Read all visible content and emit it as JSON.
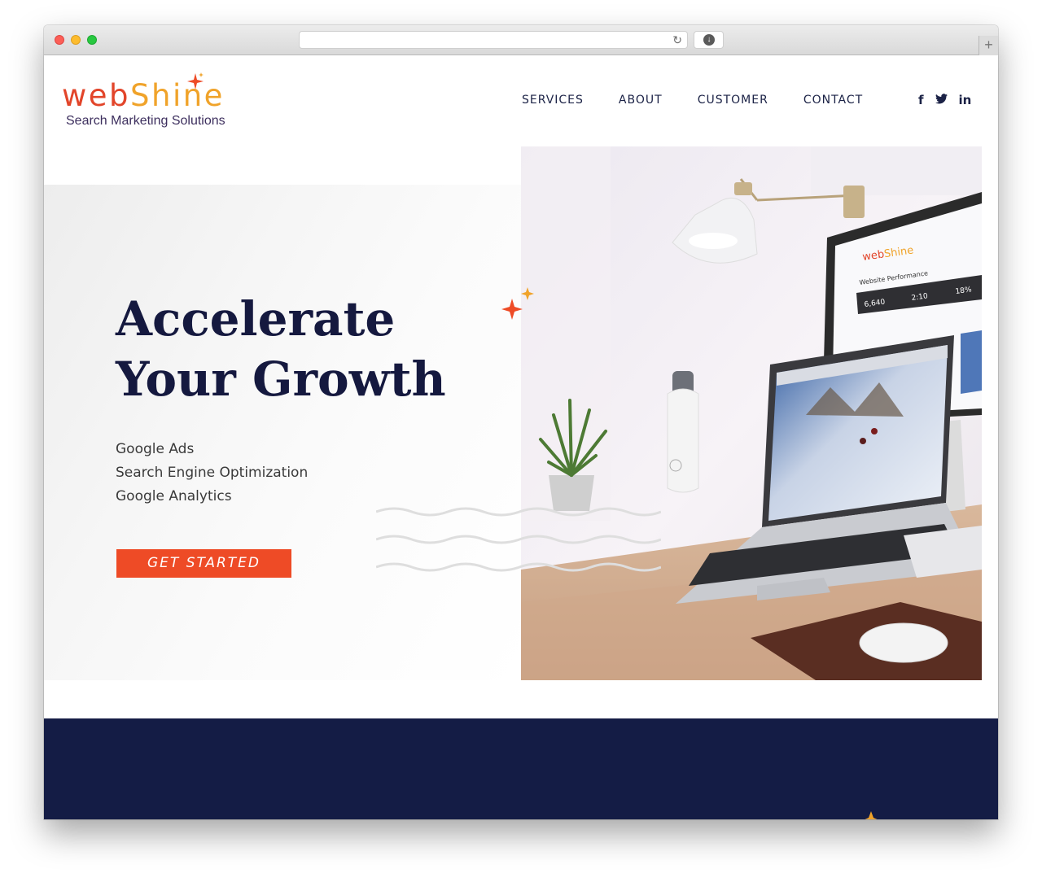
{
  "browser": {
    "url": "",
    "new_tab_label": "+",
    "reload_label": "↻",
    "download_label": "↓"
  },
  "brand": {
    "logo_web": "web",
    "logo_shine": "Shine",
    "tagline": "Search Marketing Solutions",
    "colors": {
      "primary": "#ee4b26",
      "accent": "#f0a32a",
      "navy": "#141c45"
    }
  },
  "nav": {
    "items": [
      "SERVICES",
      "ABOUT",
      "CUSTOMER",
      "CONTACT"
    ]
  },
  "social": {
    "facebook": "f",
    "twitter": "🐦",
    "linkedin": "in"
  },
  "hero": {
    "title_line1": "Accelerate",
    "title_line2": "Your Growth",
    "services": [
      "Google Ads",
      "Search Engine Optimization",
      "Google Analytics"
    ],
    "cta_label": "GET STARTED"
  },
  "photo": {
    "monitor_logo_web": "web",
    "monitor_logo_shine": "Shine",
    "monitor_heading": "Website Performance",
    "stat1": "6,640",
    "stat2": "2:10",
    "stat3": "18%"
  }
}
